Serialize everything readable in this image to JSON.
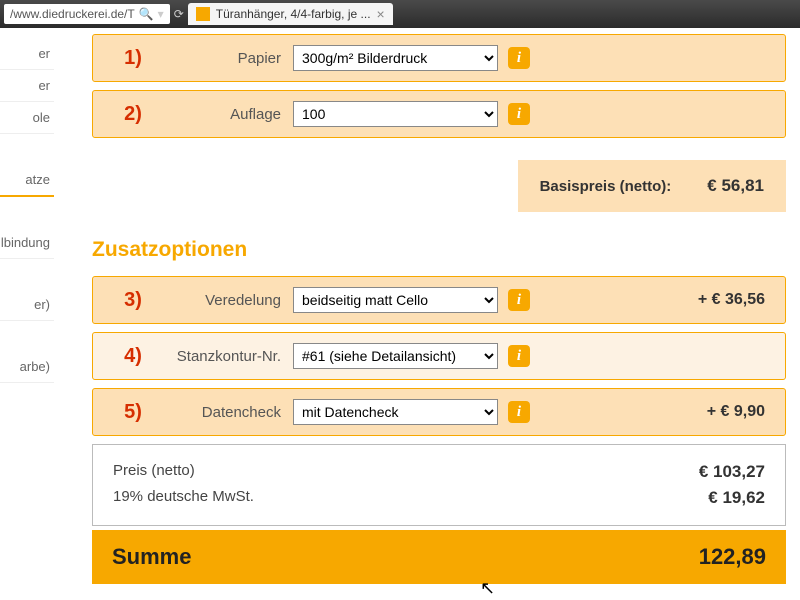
{
  "chrome": {
    "url": "/www.diedruckerei.de/T",
    "tab_title": "Türanhänger, 4/4-farbig, je ..."
  },
  "sidebar": {
    "items": [
      "er",
      "er",
      "ole",
      "atze",
      "lbindung",
      "er)",
      "arbe)"
    ]
  },
  "config": {
    "step1": {
      "num": "1)",
      "label": "Papier",
      "value": "300g/m² Bilderdruck"
    },
    "step2": {
      "num": "2)",
      "label": "Auflage",
      "value": "100"
    },
    "basis_label": "Basispreis (netto):",
    "basis_price": "€ 56,81"
  },
  "extras": {
    "title": "Zusatzoptionen",
    "step3": {
      "num": "3)",
      "label": "Veredelung",
      "value": "beidseitig matt Cello",
      "price": "+ € 36,56"
    },
    "step4": {
      "num": "4)",
      "label": "Stanzkontur-Nr.",
      "value": "#61 (siehe Detailansicht)"
    },
    "step5": {
      "num": "5)",
      "label": "Datencheck",
      "value": "mit Datencheck",
      "price": "+ € 9,90"
    }
  },
  "summary": {
    "net_label": "Preis (netto)",
    "net_value": "€ 103,27",
    "vat_label": "19% deutsche MwSt.",
    "vat_value": "€ 19,62",
    "total_label": "Summe",
    "total_value": "122,89"
  }
}
